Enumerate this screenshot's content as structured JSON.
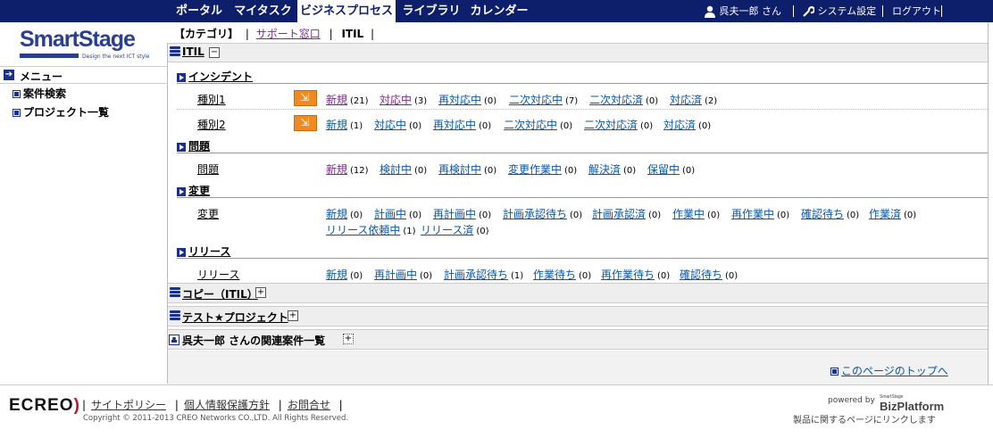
{
  "nav": {
    "tabs": [
      "ポータル",
      "マイタスク",
      "ビジネスプロセス",
      "ライブラリ",
      "カレンダー"
    ],
    "user": "呉夫一郎 さん",
    "system_settings": "システム設定",
    "logout": "ログアウト"
  },
  "logo": {
    "name": "SmartStage",
    "tagline": "Design the next ICT style"
  },
  "sidebar": {
    "menu_title": "メニュー",
    "items": [
      "案件検索",
      "プロジェクト一覧"
    ]
  },
  "category_bar": {
    "label": "【カテゴリ】",
    "support": "サポート窓口",
    "itil": "ITIL"
  },
  "itil_section": {
    "title": "ITIL",
    "toggle": "−"
  },
  "groups": {
    "incident": {
      "title": "インシデント",
      "rows": [
        {
          "label": "種別1",
          "statuses": [
            {
              "name": "新規",
              "count": "(21)"
            },
            {
              "name": "対応中",
              "count": "(3)"
            },
            {
              "name": "再対応中",
              "count": "(0)"
            },
            {
              "name": "二次対応中",
              "count": "(7)"
            },
            {
              "name": "二次対応済",
              "count": "(0)"
            },
            {
              "name": "対応済",
              "count": "(2)"
            }
          ]
        },
        {
          "label": "種別2",
          "statuses": [
            {
              "name": "新規",
              "count": "(1)"
            },
            {
              "name": "対応中",
              "count": "(0)"
            },
            {
              "name": "再対応中",
              "count": "(0)"
            },
            {
              "name": "二次対応中",
              "count": "(0)"
            },
            {
              "name": "二次対応済",
              "count": "(0)"
            },
            {
              "name": "対応済",
              "count": "(0)"
            }
          ]
        }
      ]
    },
    "problem": {
      "title": "問題",
      "row": {
        "label": "問題",
        "statuses": [
          {
            "name": "新規",
            "count": "(12)"
          },
          {
            "name": "検討中",
            "count": "(0)"
          },
          {
            "name": "再検討中",
            "count": "(0)"
          },
          {
            "name": "変更作業中",
            "count": "(0)"
          },
          {
            "name": "解決済",
            "count": "(0)"
          },
          {
            "name": "保留中",
            "count": "(0)"
          }
        ]
      }
    },
    "change": {
      "title": "変更",
      "row": {
        "label": "変更",
        "statuses": [
          {
            "name": "新規",
            "count": "(0)"
          },
          {
            "name": "計画中",
            "count": "(0)"
          },
          {
            "name": "再計画中",
            "count": "(0)"
          },
          {
            "name": "計画承認待ち",
            "count": "(0)"
          },
          {
            "name": "計画承認済",
            "count": "(0)"
          },
          {
            "name": "作業中",
            "count": "(0)"
          },
          {
            "name": "再作業中",
            "count": "(0)"
          },
          {
            "name": "確認待ち",
            "count": "(0)"
          },
          {
            "name": "作業済",
            "count": "(0)"
          },
          {
            "name": "リリース依頼中",
            "count": "(1)"
          },
          {
            "name": "リリース済",
            "count": "(0)"
          }
        ]
      }
    },
    "release": {
      "title": "リリース",
      "row": {
        "label": "リリース",
        "statuses": [
          {
            "name": "新規",
            "count": "(0)"
          },
          {
            "name": "再計画中",
            "count": "(0)"
          },
          {
            "name": "計画承認待ち",
            "count": "(1)"
          },
          {
            "name": "作業待ち",
            "count": "(0)"
          },
          {
            "name": "再作業待ち",
            "count": "(0)"
          },
          {
            "name": "確認待ち",
            "count": "(0)"
          }
        ]
      }
    }
  },
  "collapsed_sections": [
    "コピー（ITIL）",
    "テスト★プロジェクト",
    "呉夫一郎 さんの関連案件一覧"
  ],
  "toggle_plus": "+",
  "page_top_link": "このページのトップへ",
  "footer": {
    "brand": "ECREO",
    "links": [
      "サイトポリシー",
      "個人情報保護方針",
      "お問合せ"
    ],
    "copyright": "Copyright © 2011-2013 CREO Networks CO.,LTD. All Rights Reserved.",
    "powered_by": "powered by",
    "platform_small": "SmartStage",
    "platform": "BizPlatform",
    "product_link": "製品に関するページにリンクします"
  },
  "colors": {
    "nav_bg": "#0d1e6a",
    "link": "#0b56a8",
    "accent_orange": "#f08b23",
    "brand_red": "#c0142b"
  }
}
